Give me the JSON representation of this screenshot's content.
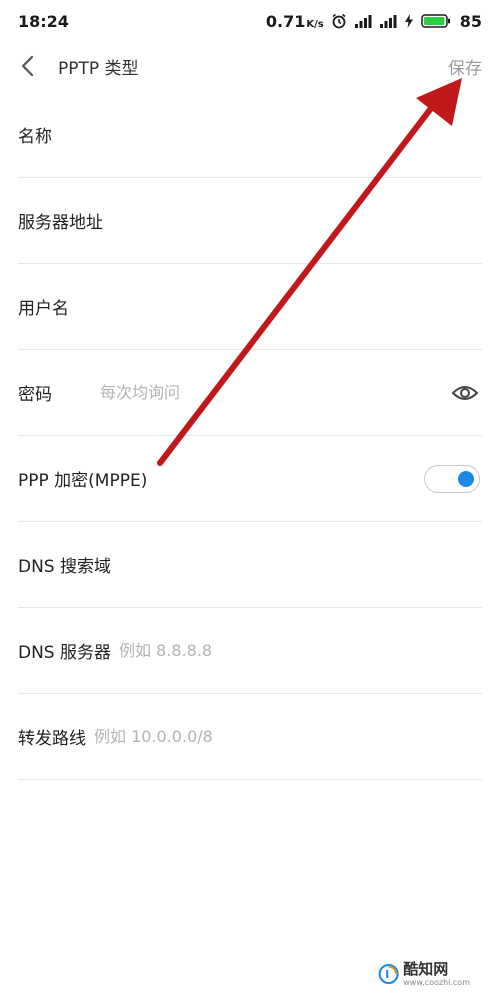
{
  "status_bar": {
    "time": "18:24",
    "net_speed": "0.71",
    "net_speed_unit": "K/s",
    "battery": "85",
    "icons": [
      "alarm-icon",
      "signal-icon",
      "signal-4g-icon",
      "charging-icon",
      "battery-icon"
    ]
  },
  "header": {
    "title": "PPTP 类型",
    "save_label": "保存",
    "back_icon": "chevron-left-icon"
  },
  "form": {
    "name": {
      "label": "名称",
      "value": ""
    },
    "server": {
      "label": "服务器地址",
      "value": ""
    },
    "username": {
      "label": "用户名",
      "value": ""
    },
    "password": {
      "label": "密码",
      "placeholder": "每次均询问",
      "value": ""
    },
    "ppp_encryption": {
      "label": "PPP 加密(MPPE)",
      "enabled": true
    },
    "dns_search": {
      "label": "DNS 搜索域",
      "value": ""
    },
    "dns_servers": {
      "label": "DNS 服务器",
      "placeholder": "例如 8.8.8.8"
    },
    "routes": {
      "label": "转发路线",
      "placeholder": "例如 10.0.0.0/8"
    }
  },
  "annotation": {
    "arrow_color": "#c0181b"
  },
  "watermark": {
    "name": "酷知网",
    "url": "www.coozhi.com"
  },
  "colors": {
    "accent": "#1e88e5",
    "save_disabled": "#9a9a9a",
    "battery": "#2ecc40"
  }
}
